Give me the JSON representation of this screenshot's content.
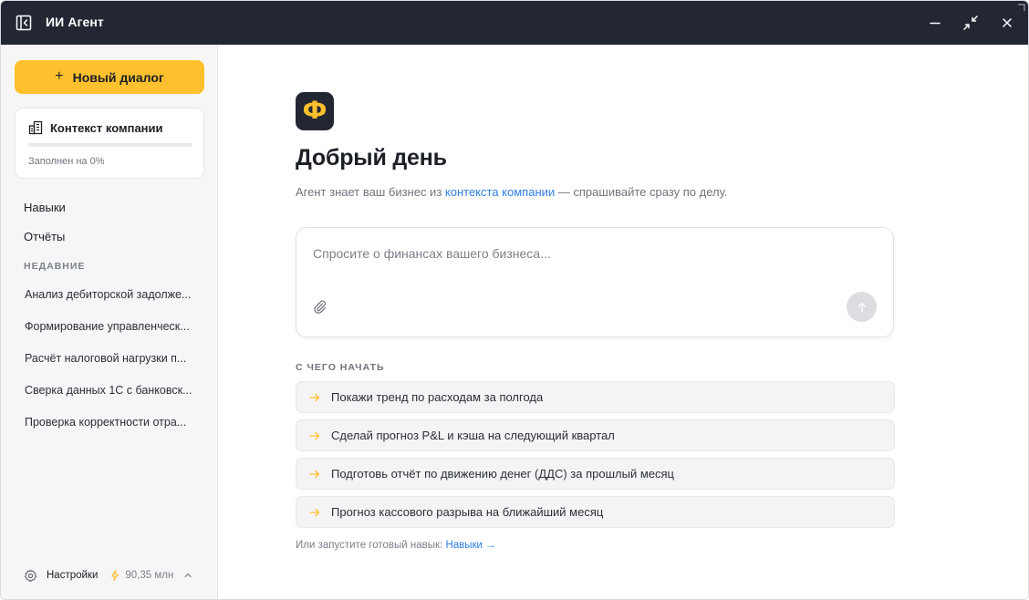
{
  "window": {
    "title": "ИИ Агент"
  },
  "sidebar": {
    "new_dialog": {
      "icon": "plus-icon",
      "label": "Новый диалог"
    },
    "context": {
      "icon": "building-icon",
      "title": "Контекст компании",
      "status": "Заполнен на 0%",
      "fill_percent": 0
    },
    "nav": [
      {
        "label": "Навыки"
      },
      {
        "label": "Отчёты"
      }
    ],
    "recent_heading": "НЕДАВНИЕ",
    "recent": [
      {
        "label": "Анализ дебиторской задолже..."
      },
      {
        "label": "Формирование управленческ..."
      },
      {
        "label": "Расчёт налоговой нагрузки п..."
      },
      {
        "label": "Сверка данных 1С с банковск..."
      },
      {
        "label": "Проверка корректности отра..."
      }
    ],
    "footer": {
      "settings_label": "Настройки",
      "balance": "90,35 млн"
    }
  },
  "main": {
    "logo_letter": "Ф",
    "greeting": "Добрый день",
    "subtitle_before": "Агент знает ваш бизнес из",
    "subtitle_link": "контекста компании",
    "subtitle_after": "— спрашивайте сразу по делу.",
    "chat": {
      "placeholder": "Спросите о финансах вашего бизнеса...",
      "value": ""
    },
    "start_heading": "С ЧЕГО НАЧАТЬ",
    "suggestions": [
      {
        "label": "Покажи тренд по расходам за полгода"
      },
      {
        "label": "Сделай прогноз P&L и кэша на следующий квартал"
      },
      {
        "label": "Подготовь отчёт по движению денег (ДДС) за прошлый месяц"
      },
      {
        "label": "Прогноз кассового разрыва на ближайший месяц"
      }
    ],
    "or_run_text": "Или запустите готовый навык:",
    "or_run_link": "Навыки →"
  },
  "colors": {
    "accent": "#ffc02e",
    "titlebar": "#232733",
    "link": "#2e7ee6",
    "sidebar_bg": "#f6f6f8"
  }
}
